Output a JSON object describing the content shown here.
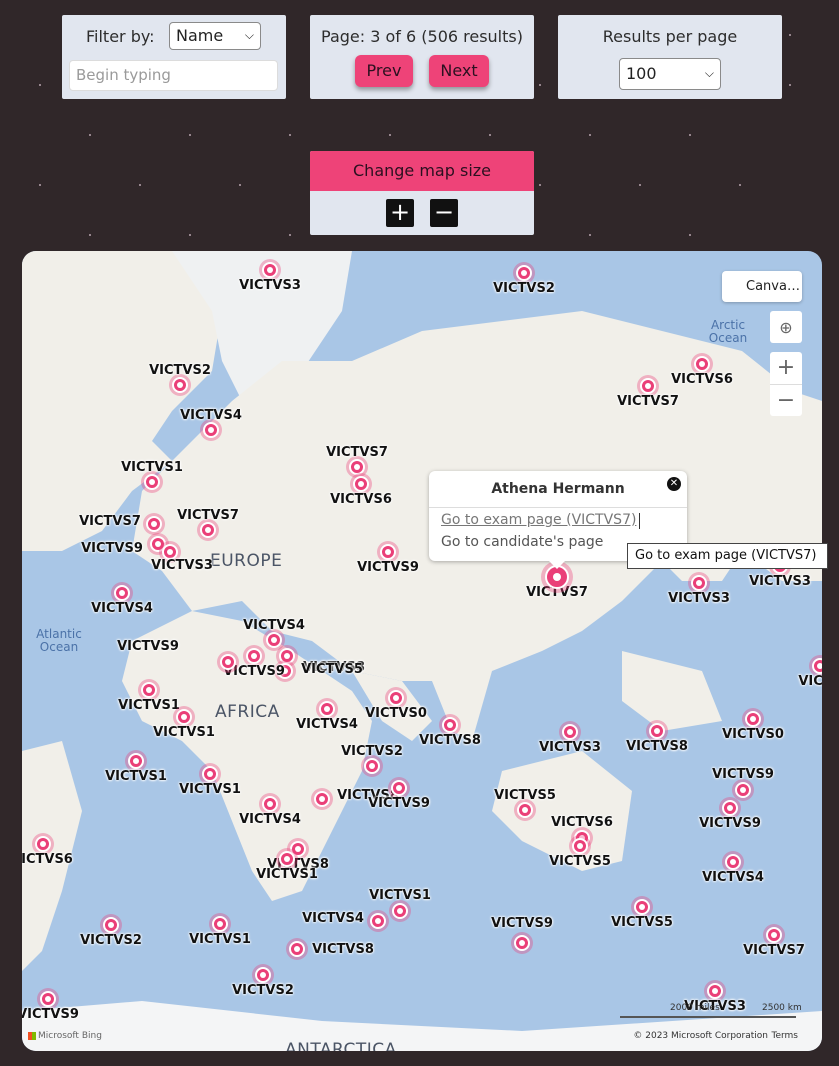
{
  "filter": {
    "label": "Filter by:",
    "selected": "Name",
    "placeholder": "Begin typing"
  },
  "pagination": {
    "info": "Page: 3 of 6 (506 results)",
    "prev_label": "Prev",
    "next_label": "Next"
  },
  "results_per_page": {
    "label": "Results per page",
    "selected": "100"
  },
  "map_size": {
    "title": "Change map size",
    "plus": "+",
    "minus": "−"
  },
  "map": {
    "style_button": "Canva…",
    "locate_icon": "locate-icon",
    "zoom_in": "+",
    "zoom_out": "−",
    "places": [
      "EUROPE",
      "AFRICA",
      "ANTARCTICA"
    ],
    "oceans": [
      "Arctic Ocean",
      "Atlantic Ocean"
    ],
    "scale_miles": "2000 miles",
    "scale_km": "2500 km",
    "copyright": "© 2023 Microsoft Corporation",
    "terms": "Terms",
    "bing": "Microsoft Bing",
    "accent_color": "#ea3f78",
    "pins": [
      {
        "label": "VICTVS3"
      },
      {
        "label": "VICTVS2"
      },
      {
        "label": "VICTVS2"
      },
      {
        "label": "VICTVS6"
      },
      {
        "label": "VICTVS7"
      },
      {
        "label": "VICTVS4"
      },
      {
        "label": "VICTVS7"
      },
      {
        "label": "VICTVS6"
      },
      {
        "label": "VICTVS1"
      },
      {
        "label": "VICTVS7"
      },
      {
        "label": "VICTVS7"
      },
      {
        "label": "VICTVS9"
      },
      {
        "label": "VICTVS3"
      },
      {
        "label": "VICTVS9"
      },
      {
        "label": "VICTVS7"
      },
      {
        "label": "VICTVS3"
      },
      {
        "label": "VICTVS3"
      },
      {
        "label": "VICTVS4"
      },
      {
        "label": "VICTVS4"
      },
      {
        "label": "VICTVS8"
      },
      {
        "label": "VICTVS5"
      },
      {
        "label": "VICTVS9"
      },
      {
        "label": "VICTVS9"
      },
      {
        "label": "VICTVS1"
      },
      {
        "label": "VICTVS1"
      },
      {
        "label": "VICTVS0"
      },
      {
        "label": "VICTVS4"
      },
      {
        "label": "VICTVS8"
      },
      {
        "label": "VICTVS3"
      },
      {
        "label": "VICTVS8"
      },
      {
        "label": "VICTVS0"
      },
      {
        "label": "VICTVS2"
      },
      {
        "label": "VICTVS1"
      },
      {
        "label": "VICTVS1"
      },
      {
        "label": "VICTVS8"
      },
      {
        "label": "VICTVS9"
      },
      {
        "label": "VICTVS9"
      },
      {
        "label": "VICTVS9"
      },
      {
        "label": "VICTVS5"
      },
      {
        "label": "VICTVS4"
      },
      {
        "label": "VICTVS6"
      },
      {
        "label": "VICTVS8"
      },
      {
        "label": "VICTVS5"
      },
      {
        "label": "VICTVS1"
      },
      {
        "label": "VICTVS4"
      },
      {
        "label": "ICTVS6"
      },
      {
        "label": "VICTVS1"
      },
      {
        "label": "VICTVS4"
      },
      {
        "label": "VICTVS5"
      },
      {
        "label": "VICTVS2"
      },
      {
        "label": "VICTVS1"
      },
      {
        "label": "VICTVS8"
      },
      {
        "label": "VICTVS9"
      },
      {
        "label": "VICTVS7"
      },
      {
        "label": "VICTVS2"
      },
      {
        "label": "VICTVS3"
      },
      {
        "label": "VICTVS9"
      },
      {
        "label": "VICT"
      }
    ]
  },
  "popup": {
    "title": "Athena Hermann",
    "exam_link": "Go to exam page (VICTVS7)",
    "candidate_link": "Go to candidate's page",
    "close_icon": "close-icon"
  },
  "tooltip": {
    "text": "Go to exam page (VICTVS7)"
  }
}
